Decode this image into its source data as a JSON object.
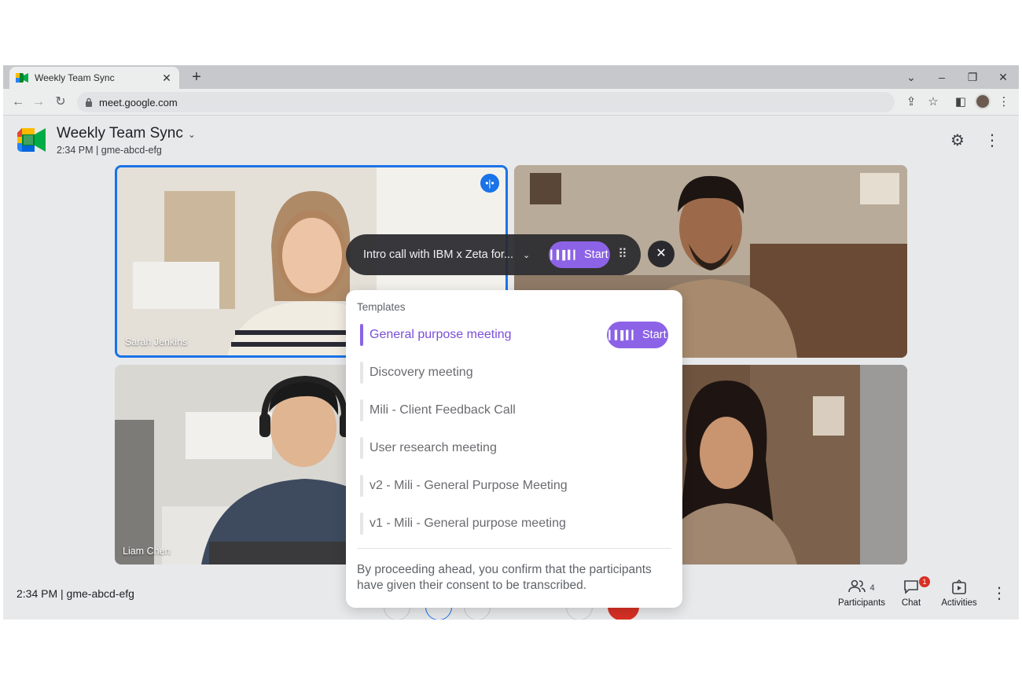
{
  "browser": {
    "tab_title": "Weekly Team Sync",
    "url": "meet.google.com"
  },
  "meeting": {
    "title": "Weekly Team Sync",
    "time": "2:34 PM",
    "code": "gme-abcd-efg",
    "subtitle": "2:34 PM | gme-abcd-efg"
  },
  "participants_tiles": [
    {
      "name": "Sarah Jenkins"
    },
    {
      "name": ""
    },
    {
      "name": "Liam Chen"
    },
    {
      "name": ""
    }
  ],
  "notetaker_bar": {
    "selected_template": "Intro call with IBM x Zeta for...",
    "start_label": "Start"
  },
  "templates_popup": {
    "header": "Templates",
    "items": [
      {
        "name": "General purpose meeting",
        "active": true
      },
      {
        "name": "Discovery meeting",
        "active": false
      },
      {
        "name": "Mili - Client Feedback Call",
        "active": false
      },
      {
        "name": "User research meeting",
        "active": false
      },
      {
        "name": "v2 - Mili - General Purpose Meeting",
        "active": false
      },
      {
        "name": "v1 - Mili - General purpose meeting",
        "active": false
      }
    ],
    "start_label": "Start",
    "consent": "By proceeding ahead, you confirm that the participants have given their consent to be transcribed."
  },
  "bottom_bar": {
    "time_code": "2:34 PM  |  gme-abcd-efg",
    "participants_label": "Participants",
    "participants_count": "4",
    "chat_label": "Chat",
    "chat_badge": "1",
    "activities_label": "Activities"
  },
  "colors": {
    "accent": "#8c63e6",
    "speaking_border": "#1a73e8",
    "badge": "#d93025"
  }
}
